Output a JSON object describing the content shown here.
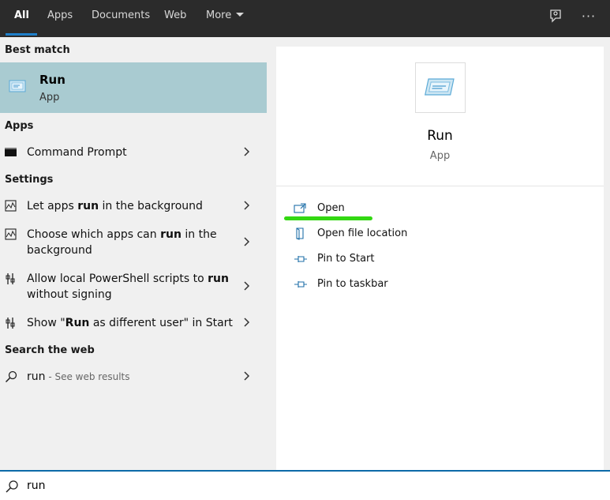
{
  "tabs": {
    "all": "All",
    "apps": "Apps",
    "documents": "Documents",
    "web": "Web",
    "more": "More"
  },
  "top_icons": {
    "feedback": "feedback-icon",
    "more_options": "ellipsis-icon",
    "more_options_glyph": "···"
  },
  "left": {
    "best_match_header": "Best match",
    "best_match": {
      "title": "Run",
      "subtitle": "App",
      "icon": "run-icon"
    },
    "apps_header": "Apps",
    "apps": [
      {
        "label": "Command Prompt",
        "icon": "command-prompt-icon"
      }
    ],
    "settings_header": "Settings",
    "settings": [
      {
        "pre": "Let apps ",
        "bold": "run",
        "post": " in the background",
        "icon": "settings-activity-icon"
      },
      {
        "pre": "Choose which apps can ",
        "bold": "run",
        "post": " in the background",
        "icon": "settings-activity-icon"
      },
      {
        "pre": "Allow local PowerShell scripts to ",
        "bold": "run",
        "post": " without signing",
        "icon": "developer-tools-icon"
      },
      {
        "pre": "Show \"",
        "bold": "Run",
        "post": " as different user\" in Start",
        "icon": "developer-tools-icon"
      }
    ],
    "web_header": "Search the web",
    "web": {
      "query": "run",
      "suffix": " - See web results",
      "icon": "search-icon"
    }
  },
  "right": {
    "app_name": "Run",
    "app_type": "App",
    "actions": [
      {
        "label": "Open",
        "icon": "open-icon"
      },
      {
        "label": "Open file location",
        "icon": "file-location-icon"
      },
      {
        "label": "Pin to Start",
        "icon": "pin-icon"
      },
      {
        "label": "Pin to taskbar",
        "icon": "pin-icon"
      }
    ],
    "highlight_color": "#33d812"
  },
  "search": {
    "value": "run",
    "icon": "search-icon"
  },
  "colors": {
    "accent": "#1e7fc9",
    "selected_bg": "#a9cbd1",
    "topbar_bg": "#2b2b2b"
  }
}
